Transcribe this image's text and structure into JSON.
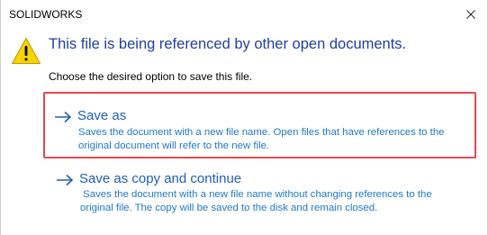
{
  "window": {
    "title": "SOLIDWORKS",
    "close_glyph": "✕"
  },
  "message": {
    "icon": "warning-icon",
    "heading": "This file is being referenced by other open documents.",
    "instruction": "Choose the desired option to save this file."
  },
  "options": [
    {
      "icon": "arrow-right-icon",
      "label": "Save as",
      "description_line1": "Saves the document with a new file name. Open files that have references to the",
      "description_line2": "original document will refer to the new file.",
      "selected": true
    },
    {
      "icon": "arrow-right-icon",
      "label": "Save as copy and continue",
      "description_line1": " Saves the document with a new file name without changing references to the",
      "description_line2": "original file. The copy will be saved to the disk and remain closed.",
      "selected": false
    }
  ],
  "colors": {
    "heading": "#1f3f9e",
    "option_label": "#1f5fb4",
    "option_description": "#1f78c8",
    "selection_border": "#e24a4f",
    "warning_fill": "#f5d400"
  }
}
